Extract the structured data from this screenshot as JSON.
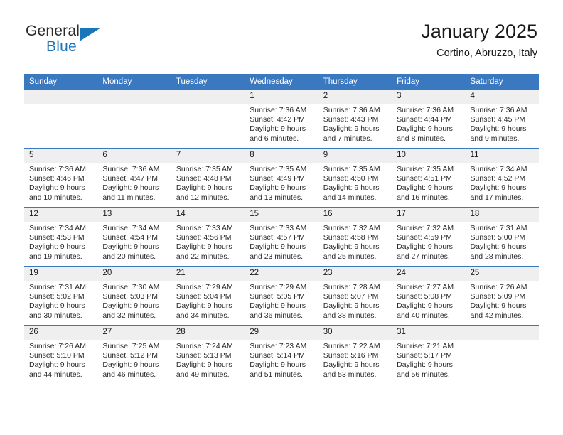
{
  "brand": {
    "name_part1": "General",
    "name_part2": "Blue",
    "logo_icon": "triangle-flag-icon",
    "accent_color": "#1b75bb"
  },
  "header": {
    "title": "January 2025",
    "subtitle": "Cortino, Abruzzo, Italy"
  },
  "theme": {
    "header_blue": "#3a78bf",
    "daynum_bg": "#efefef",
    "text": "#1a1a1a"
  },
  "weekdays": [
    "Sunday",
    "Monday",
    "Tuesday",
    "Wednesday",
    "Thursday",
    "Friday",
    "Saturday"
  ],
  "weeks": [
    [
      {
        "day": "",
        "empty": true
      },
      {
        "day": "",
        "empty": true
      },
      {
        "day": "",
        "empty": true
      },
      {
        "day": "1",
        "sunrise": "Sunrise: 7:36 AM",
        "sunset": "Sunset: 4:42 PM",
        "daylight1": "Daylight: 9 hours",
        "daylight2": "and 6 minutes."
      },
      {
        "day": "2",
        "sunrise": "Sunrise: 7:36 AM",
        "sunset": "Sunset: 4:43 PM",
        "daylight1": "Daylight: 9 hours",
        "daylight2": "and 7 minutes."
      },
      {
        "day": "3",
        "sunrise": "Sunrise: 7:36 AM",
        "sunset": "Sunset: 4:44 PM",
        "daylight1": "Daylight: 9 hours",
        "daylight2": "and 8 minutes."
      },
      {
        "day": "4",
        "sunrise": "Sunrise: 7:36 AM",
        "sunset": "Sunset: 4:45 PM",
        "daylight1": "Daylight: 9 hours",
        "daylight2": "and 9 minutes."
      }
    ],
    [
      {
        "day": "5",
        "sunrise": "Sunrise: 7:36 AM",
        "sunset": "Sunset: 4:46 PM",
        "daylight1": "Daylight: 9 hours",
        "daylight2": "and 10 minutes."
      },
      {
        "day": "6",
        "sunrise": "Sunrise: 7:36 AM",
        "sunset": "Sunset: 4:47 PM",
        "daylight1": "Daylight: 9 hours",
        "daylight2": "and 11 minutes."
      },
      {
        "day": "7",
        "sunrise": "Sunrise: 7:35 AM",
        "sunset": "Sunset: 4:48 PM",
        "daylight1": "Daylight: 9 hours",
        "daylight2": "and 12 minutes."
      },
      {
        "day": "8",
        "sunrise": "Sunrise: 7:35 AM",
        "sunset": "Sunset: 4:49 PM",
        "daylight1": "Daylight: 9 hours",
        "daylight2": "and 13 minutes."
      },
      {
        "day": "9",
        "sunrise": "Sunrise: 7:35 AM",
        "sunset": "Sunset: 4:50 PM",
        "daylight1": "Daylight: 9 hours",
        "daylight2": "and 14 minutes."
      },
      {
        "day": "10",
        "sunrise": "Sunrise: 7:35 AM",
        "sunset": "Sunset: 4:51 PM",
        "daylight1": "Daylight: 9 hours",
        "daylight2": "and 16 minutes."
      },
      {
        "day": "11",
        "sunrise": "Sunrise: 7:34 AM",
        "sunset": "Sunset: 4:52 PM",
        "daylight1": "Daylight: 9 hours",
        "daylight2": "and 17 minutes."
      }
    ],
    [
      {
        "day": "12",
        "sunrise": "Sunrise: 7:34 AM",
        "sunset": "Sunset: 4:53 PM",
        "daylight1": "Daylight: 9 hours",
        "daylight2": "and 19 minutes."
      },
      {
        "day": "13",
        "sunrise": "Sunrise: 7:34 AM",
        "sunset": "Sunset: 4:54 PM",
        "daylight1": "Daylight: 9 hours",
        "daylight2": "and 20 minutes."
      },
      {
        "day": "14",
        "sunrise": "Sunrise: 7:33 AM",
        "sunset": "Sunset: 4:56 PM",
        "daylight1": "Daylight: 9 hours",
        "daylight2": "and 22 minutes."
      },
      {
        "day": "15",
        "sunrise": "Sunrise: 7:33 AM",
        "sunset": "Sunset: 4:57 PM",
        "daylight1": "Daylight: 9 hours",
        "daylight2": "and 23 minutes."
      },
      {
        "day": "16",
        "sunrise": "Sunrise: 7:32 AM",
        "sunset": "Sunset: 4:58 PM",
        "daylight1": "Daylight: 9 hours",
        "daylight2": "and 25 minutes."
      },
      {
        "day": "17",
        "sunrise": "Sunrise: 7:32 AM",
        "sunset": "Sunset: 4:59 PM",
        "daylight1": "Daylight: 9 hours",
        "daylight2": "and 27 minutes."
      },
      {
        "day": "18",
        "sunrise": "Sunrise: 7:31 AM",
        "sunset": "Sunset: 5:00 PM",
        "daylight1": "Daylight: 9 hours",
        "daylight2": "and 28 minutes."
      }
    ],
    [
      {
        "day": "19",
        "sunrise": "Sunrise: 7:31 AM",
        "sunset": "Sunset: 5:02 PM",
        "daylight1": "Daylight: 9 hours",
        "daylight2": "and 30 minutes."
      },
      {
        "day": "20",
        "sunrise": "Sunrise: 7:30 AM",
        "sunset": "Sunset: 5:03 PM",
        "daylight1": "Daylight: 9 hours",
        "daylight2": "and 32 minutes."
      },
      {
        "day": "21",
        "sunrise": "Sunrise: 7:29 AM",
        "sunset": "Sunset: 5:04 PM",
        "daylight1": "Daylight: 9 hours",
        "daylight2": "and 34 minutes."
      },
      {
        "day": "22",
        "sunrise": "Sunrise: 7:29 AM",
        "sunset": "Sunset: 5:05 PM",
        "daylight1": "Daylight: 9 hours",
        "daylight2": "and 36 minutes."
      },
      {
        "day": "23",
        "sunrise": "Sunrise: 7:28 AM",
        "sunset": "Sunset: 5:07 PM",
        "daylight1": "Daylight: 9 hours",
        "daylight2": "and 38 minutes."
      },
      {
        "day": "24",
        "sunrise": "Sunrise: 7:27 AM",
        "sunset": "Sunset: 5:08 PM",
        "daylight1": "Daylight: 9 hours",
        "daylight2": "and 40 minutes."
      },
      {
        "day": "25",
        "sunrise": "Sunrise: 7:26 AM",
        "sunset": "Sunset: 5:09 PM",
        "daylight1": "Daylight: 9 hours",
        "daylight2": "and 42 minutes."
      }
    ],
    [
      {
        "day": "26",
        "sunrise": "Sunrise: 7:26 AM",
        "sunset": "Sunset: 5:10 PM",
        "daylight1": "Daylight: 9 hours",
        "daylight2": "and 44 minutes."
      },
      {
        "day": "27",
        "sunrise": "Sunrise: 7:25 AM",
        "sunset": "Sunset: 5:12 PM",
        "daylight1": "Daylight: 9 hours",
        "daylight2": "and 46 minutes."
      },
      {
        "day": "28",
        "sunrise": "Sunrise: 7:24 AM",
        "sunset": "Sunset: 5:13 PM",
        "daylight1": "Daylight: 9 hours",
        "daylight2": "and 49 minutes."
      },
      {
        "day": "29",
        "sunrise": "Sunrise: 7:23 AM",
        "sunset": "Sunset: 5:14 PM",
        "daylight1": "Daylight: 9 hours",
        "daylight2": "and 51 minutes."
      },
      {
        "day": "30",
        "sunrise": "Sunrise: 7:22 AM",
        "sunset": "Sunset: 5:16 PM",
        "daylight1": "Daylight: 9 hours",
        "daylight2": "and 53 minutes."
      },
      {
        "day": "31",
        "sunrise": "Sunrise: 7:21 AM",
        "sunset": "Sunset: 5:17 PM",
        "daylight1": "Daylight: 9 hours",
        "daylight2": "and 56 minutes."
      },
      {
        "day": "",
        "empty": true
      }
    ]
  ]
}
